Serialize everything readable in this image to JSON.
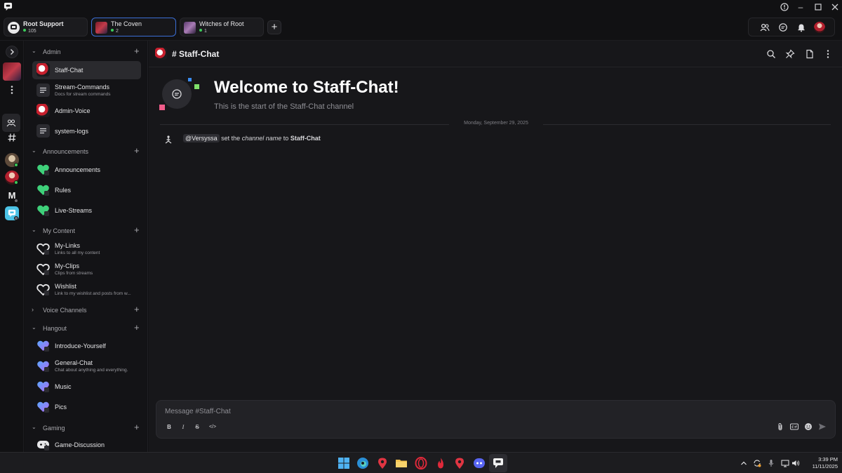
{
  "window": {
    "app": "Root"
  },
  "servers": [
    {
      "name": "Root Support",
      "online": "105"
    },
    {
      "name": "The Coven",
      "online": "2"
    },
    {
      "name": "Witches of Root",
      "online": "1"
    }
  ],
  "sidebar": {
    "categories": {
      "admin": "Admin",
      "announcements": "Announcements",
      "my_content": "My Content",
      "voice": "Voice Channels",
      "hangout": "Hangout",
      "gaming": "Gaming"
    },
    "channels": {
      "staff_chat": {
        "name": "Staff-Chat"
      },
      "stream_commands": {
        "name": "Stream-Commands",
        "desc": "Docs for stream commands"
      },
      "admin_voice": {
        "name": "Admin-Voice"
      },
      "system_logs": {
        "name": "system-logs"
      },
      "announcements": {
        "name": "Announcements"
      },
      "rules": {
        "name": "Rules"
      },
      "live_streams": {
        "name": "Live-Streams"
      },
      "my_links": {
        "name": "My-Links",
        "desc": "Links to all my content"
      },
      "my_clips": {
        "name": "My-Clips",
        "desc": "Clips from streams"
      },
      "wishlist": {
        "name": "Wishlist",
        "desc": "Link to my wishlist and posts from w..."
      },
      "introduce": {
        "name": "Introduce-Yourself"
      },
      "general": {
        "name": "General-Chat",
        "desc": "Chat about anything and everything."
      },
      "music": {
        "name": "Music"
      },
      "pics": {
        "name": "Pics"
      },
      "game_discussion": {
        "name": "Game-Discussion"
      }
    }
  },
  "main": {
    "header_title": "# Staff-Chat",
    "welcome_title": "Welcome to Staff-Chat!",
    "welcome_sub": "This is the start of the Staff-Chat channel",
    "date_divider": "Monday, September 29, 2025",
    "system_message": {
      "user": "@Versyssa",
      "pre": "set the",
      "field": "channel name",
      "mid": "to",
      "value": "Staff-Chat"
    },
    "composer": {
      "placeholder": "Message #Staff-Chat",
      "format": {
        "bold": "B",
        "italic": "I",
        "strike": "S",
        "code": "</>"
      }
    }
  },
  "taskbar": {
    "time": "3:39 PM",
    "date": "11/11/2025"
  },
  "colors": {
    "accent": "#3b6fd6",
    "online": "#3ccb5a",
    "background": "#17171a"
  }
}
